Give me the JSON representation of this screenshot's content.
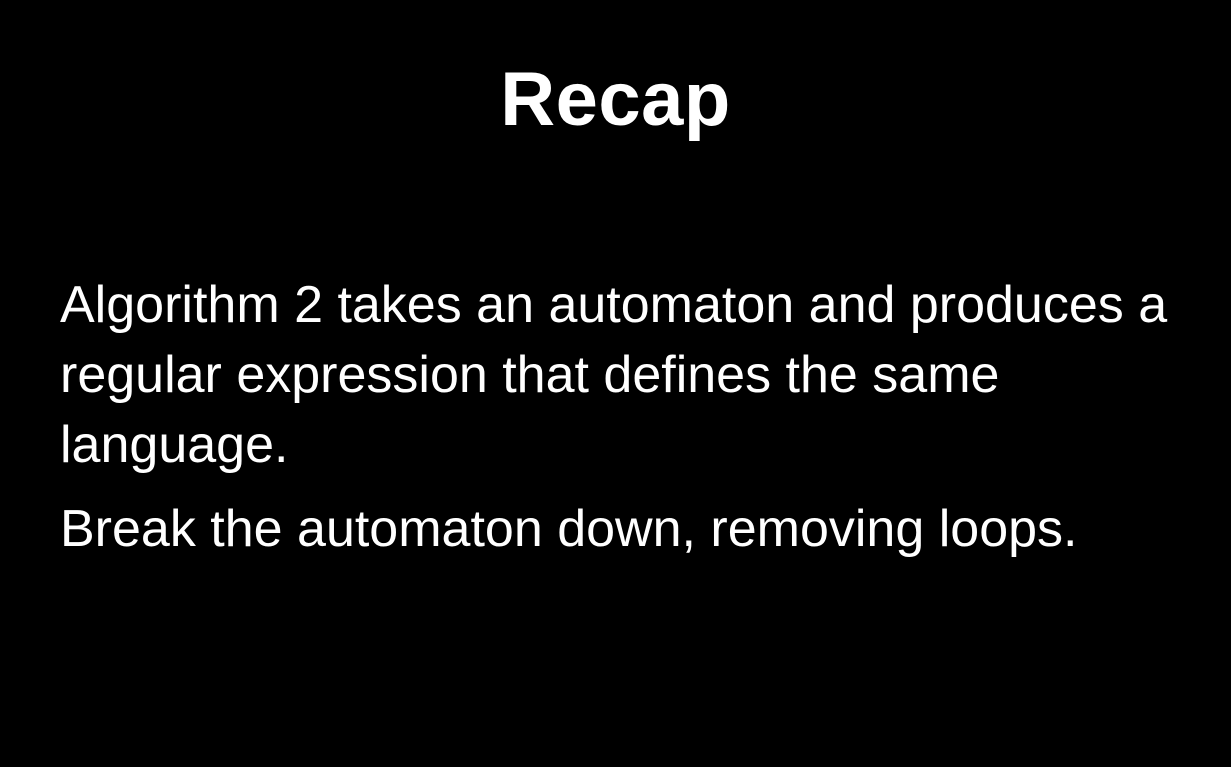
{
  "slide": {
    "title": "Recap",
    "bullets": [
      "Algorithm 2 takes an automaton and produces a regular expression that defines the same language.",
      "Break the automaton down, removing loops."
    ]
  },
  "colors": {
    "background": "#000000",
    "text": "#ffffff"
  }
}
